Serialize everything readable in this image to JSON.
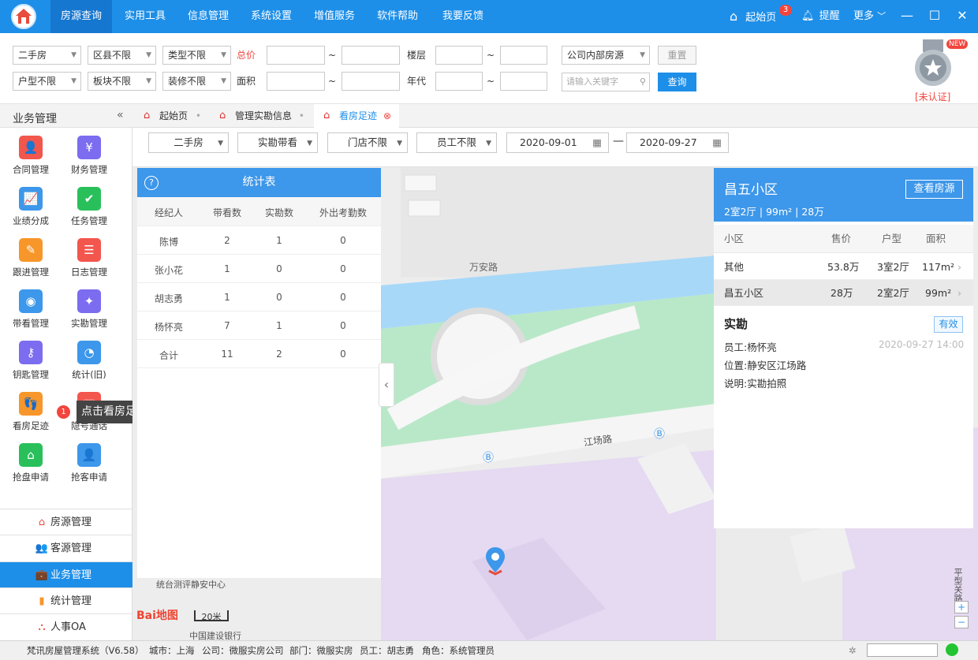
{
  "topbar": {
    "menu": [
      "房源查询",
      "实用工具",
      "信息管理",
      "系统设置",
      "增值服务",
      "软件帮助",
      "我要反馈"
    ],
    "home_label": "起始页",
    "home_badge": "3",
    "remind_label": "提醒",
    "more_label": "更多"
  },
  "filters": {
    "row1": {
      "type": "二手房",
      "district": "区县不限",
      "category": "类型不限",
      "price_label": "总价",
      "floor_label": "楼层",
      "source": "公司内部房源",
      "reset": "重置",
      "tilde": "~"
    },
    "row2": {
      "layout": "户型不限",
      "block": "板块不限",
      "decoration": "装修不限",
      "area_label": "面积",
      "year_label": "年代",
      "keyword_placeholder": "请输入关键字",
      "query": "查询"
    },
    "unverified": "[未认证]",
    "new_badge": "NEW"
  },
  "sidebar": {
    "title": "业务管理",
    "collapse": "«",
    "items": [
      {
        "label": "合同管理",
        "color": "#f2564d",
        "icon": "contract-icon",
        "glyph": "👤"
      },
      {
        "label": "财务管理",
        "color": "#7b6cf0",
        "icon": "finance-icon",
        "glyph": "¥"
      },
      {
        "label": "业绩分成",
        "color": "#3d97ea",
        "icon": "performance-icon",
        "glyph": "📈"
      },
      {
        "label": "任务管理",
        "color": "#29c05c",
        "icon": "task-icon",
        "glyph": "✔"
      },
      {
        "label": "跟进管理",
        "color": "#f7962a",
        "icon": "followup-icon",
        "glyph": "✎"
      },
      {
        "label": "日志管理",
        "color": "#f2564d",
        "icon": "log-icon",
        "glyph": "☰"
      },
      {
        "label": "带看管理",
        "color": "#3d97ea",
        "icon": "eye-icon",
        "glyph": "◉"
      },
      {
        "label": "实勘管理",
        "color": "#7b6cf0",
        "icon": "survey-icon",
        "glyph": "✦"
      },
      {
        "label": "钥匙管理",
        "color": "#7b6cf0",
        "icon": "key-icon",
        "glyph": "⚷"
      },
      {
        "label": "统计(旧)",
        "color": "#3d97ea",
        "icon": "pie-chart-icon",
        "glyph": "◔"
      },
      {
        "label": "看房足迹",
        "color": "#f7962a",
        "icon": "footprint-icon",
        "glyph": "👣"
      },
      {
        "label": "隐号通话",
        "color": "#f2564d",
        "icon": "phone-icon",
        "glyph": "☏"
      },
      {
        "label": "抢盘申请",
        "color": "#29c05c",
        "icon": "grab-house-icon",
        "glyph": "⌂"
      },
      {
        "label": "抢客申请",
        "color": "#3d97ea",
        "icon": "grab-client-icon",
        "glyph": "👤"
      }
    ],
    "tooltip": "点击看房足迹",
    "tooltip_num": "1",
    "modules": [
      {
        "label": "房源管理",
        "icon": "house-icon",
        "glyph": "⌂"
      },
      {
        "label": "客源管理",
        "icon": "clients-icon",
        "glyph": "👥"
      },
      {
        "label": "业务管理",
        "icon": "briefcase-icon",
        "glyph": "💼"
      },
      {
        "label": "统计管理",
        "icon": "bar-chart-icon",
        "glyph": "▮"
      },
      {
        "label": "人事OA",
        "icon": "people-icon",
        "glyph": "⛬"
      }
    ]
  },
  "tabs": [
    {
      "label": "起始页"
    },
    {
      "label": "管理实勘信息"
    },
    {
      "label": "看房足迹"
    }
  ],
  "subfilter": {
    "type": "二手房",
    "mode": "实勘带看",
    "store": "门店不限",
    "staff": "员工不限",
    "date_from": "2020-09-01",
    "date_sep": "—",
    "date_to": "2020-09-27"
  },
  "stats": {
    "title": "统计表",
    "headers": [
      "经纪人",
      "带看数",
      "实勘数",
      "外出考勤数"
    ],
    "rows": [
      [
        "陈博",
        "2",
        "1",
        "0"
      ],
      [
        "张小花",
        "1",
        "0",
        "0"
      ],
      [
        "胡志勇",
        "1",
        "0",
        "0"
      ],
      [
        "杨怀亮",
        "7",
        "1",
        "0"
      ],
      [
        "合计",
        "11",
        "2",
        "0"
      ]
    ]
  },
  "map": {
    "road1": "万安路",
    "road2": "江场路",
    "poi1": "统台测评静安中心",
    "poi2": "中国建设银行",
    "road3": "平型关路",
    "scale": "20米",
    "logo": "Bai地图"
  },
  "detail": {
    "title": "昌五小区",
    "subtitle": "2室2厅 | 99m² | 28万",
    "view_button": "查看房源",
    "table_headers": [
      "小区",
      "售价",
      "户型",
      "面积"
    ],
    "rows": [
      [
        "其他",
        "53.8万",
        "3室2厅",
        "117m²"
      ],
      [
        "昌五小区",
        "28万",
        "2室2厅",
        "99m²"
      ]
    ],
    "section_title": "实勘",
    "valid": "有效",
    "staff": "员工:杨怀亮",
    "time": "2020-09-27 14:00",
    "location": "位置:静安区江场路",
    "note": "说明:实勘拍照"
  },
  "status": {
    "app": "梵讯房屋管理系统（V6.58）",
    "city": "城市：上海",
    "company": "公司：微服实房公司",
    "dept": "部门：微服实房",
    "staff": "员工：胡志勇",
    "role": "角色：系统管理员"
  }
}
